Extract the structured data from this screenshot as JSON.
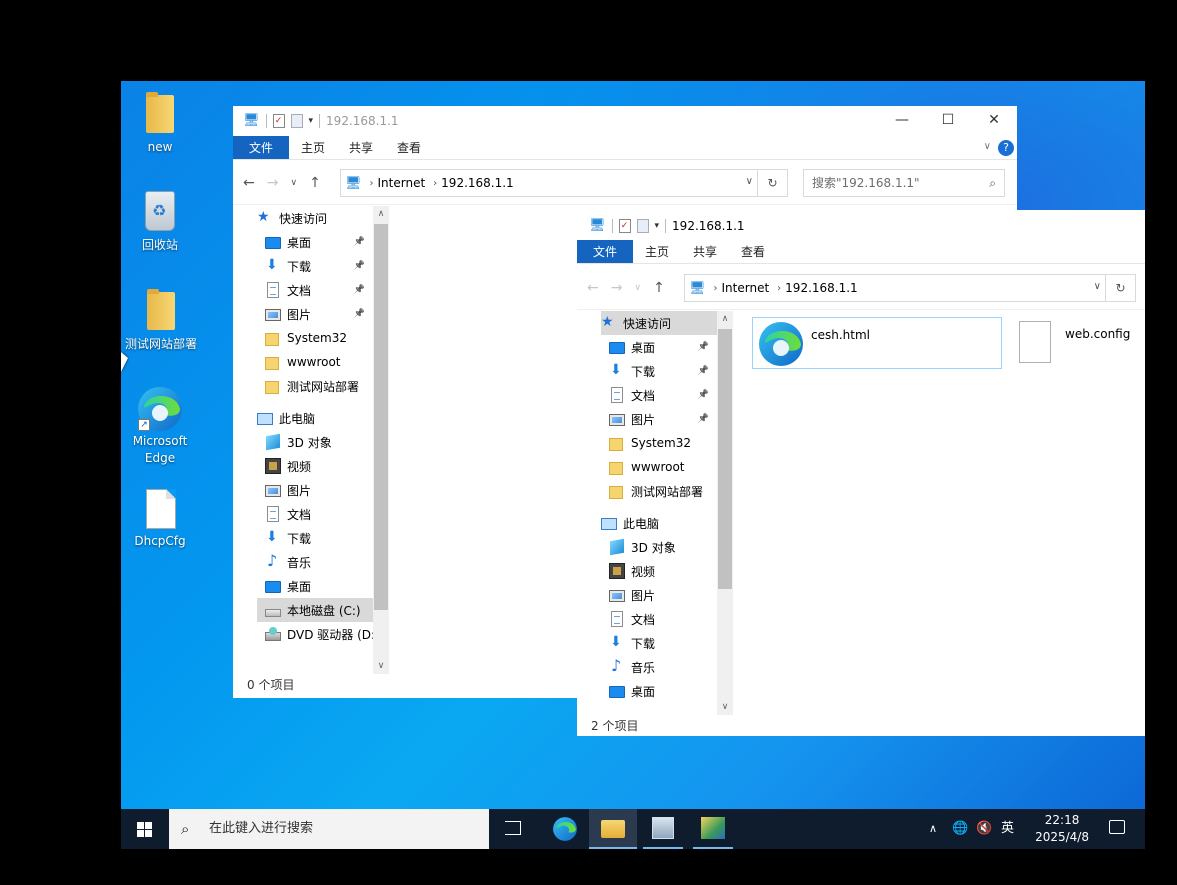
{
  "desktop": {
    "icons": [
      {
        "label": "new",
        "icon": "folder-icon"
      },
      {
        "label": "回收站",
        "icon": "recycle-bin-icon"
      },
      {
        "label": "测试网站部署",
        "icon": "folder-icon"
      },
      {
        "label": "Microsoft Edge",
        "icon": "edge-icon"
      },
      {
        "label": "DhcpCfg",
        "icon": "file-icon"
      }
    ]
  },
  "window_back": {
    "title": "192.168.1.1",
    "ribbon": [
      "文件",
      "主页",
      "共享",
      "查看"
    ],
    "address": [
      "Internet",
      "192.168.1.1"
    ],
    "search_placeholder": "搜索\"192.168.1.1\"",
    "nav": [
      {
        "label": "快速访问",
        "icon": "star-icon"
      },
      {
        "label": "桌面",
        "icon": "desktop-icon",
        "pinned": true
      },
      {
        "label": "下载",
        "icon": "download-icon",
        "pinned": true
      },
      {
        "label": "文档",
        "icon": "document-icon",
        "pinned": true
      },
      {
        "label": "图片",
        "icon": "pictures-icon",
        "pinned": true
      },
      {
        "label": "System32",
        "icon": "folder-icon"
      },
      {
        "label": "wwwroot",
        "icon": "folder-icon"
      },
      {
        "label": "测试网站部署",
        "icon": "folder-icon"
      },
      {
        "label": "此电脑",
        "icon": "pc-icon"
      },
      {
        "label": "3D 对象",
        "icon": "3d-objects-icon"
      },
      {
        "label": "视频",
        "icon": "video-icon"
      },
      {
        "label": "图片",
        "icon": "pictures-icon"
      },
      {
        "label": "文档",
        "icon": "document-icon"
      },
      {
        "label": "下载",
        "icon": "download-icon"
      },
      {
        "label": "音乐",
        "icon": "music-icon"
      },
      {
        "label": "桌面",
        "icon": "desktop-icon"
      },
      {
        "label": "本地磁盘 (C:)",
        "icon": "drive-icon",
        "selected": true
      },
      {
        "label": "DVD 驱动器 (D:",
        "icon": "dvd-icon"
      }
    ],
    "status": "0 个项目"
  },
  "window_front": {
    "title": "192.168.1.1",
    "ribbon": [
      "文件",
      "主页",
      "共享",
      "查看"
    ],
    "address": [
      "Internet",
      "192.168.1.1"
    ],
    "nav": [
      {
        "label": "快速访问",
        "icon": "star-icon",
        "selected": true
      },
      {
        "label": "桌面",
        "icon": "desktop-icon",
        "pinned": true
      },
      {
        "label": "下载",
        "icon": "download-icon",
        "pinned": true
      },
      {
        "label": "文档",
        "icon": "document-icon",
        "pinned": true
      },
      {
        "label": "图片",
        "icon": "pictures-icon",
        "pinned": true
      },
      {
        "label": "System32",
        "icon": "folder-icon"
      },
      {
        "label": "wwwroot",
        "icon": "folder-icon"
      },
      {
        "label": "测试网站部署",
        "icon": "folder-icon"
      },
      {
        "label": "此电脑",
        "icon": "pc-icon"
      },
      {
        "label": "3D 对象",
        "icon": "3d-objects-icon"
      },
      {
        "label": "视频",
        "icon": "video-icon"
      },
      {
        "label": "图片",
        "icon": "pictures-icon"
      },
      {
        "label": "文档",
        "icon": "document-icon"
      },
      {
        "label": "下载",
        "icon": "download-icon"
      },
      {
        "label": "音乐",
        "icon": "music-icon"
      },
      {
        "label": "桌面",
        "icon": "desktop-icon"
      }
    ],
    "files": [
      {
        "name": "cesh.html",
        "icon": "edge-icon",
        "selected": true
      },
      {
        "name": "web.config",
        "icon": "file-icon"
      }
    ],
    "status": "2 个项目"
  },
  "taskbar": {
    "search_placeholder": "在此键入进行搜索",
    "ime": "英",
    "time": "22:18",
    "date": "2025/4/8"
  },
  "colors": {
    "accent": "#1565c0",
    "selection": "#cce8ff",
    "taskbar": "#0f1c2e"
  }
}
